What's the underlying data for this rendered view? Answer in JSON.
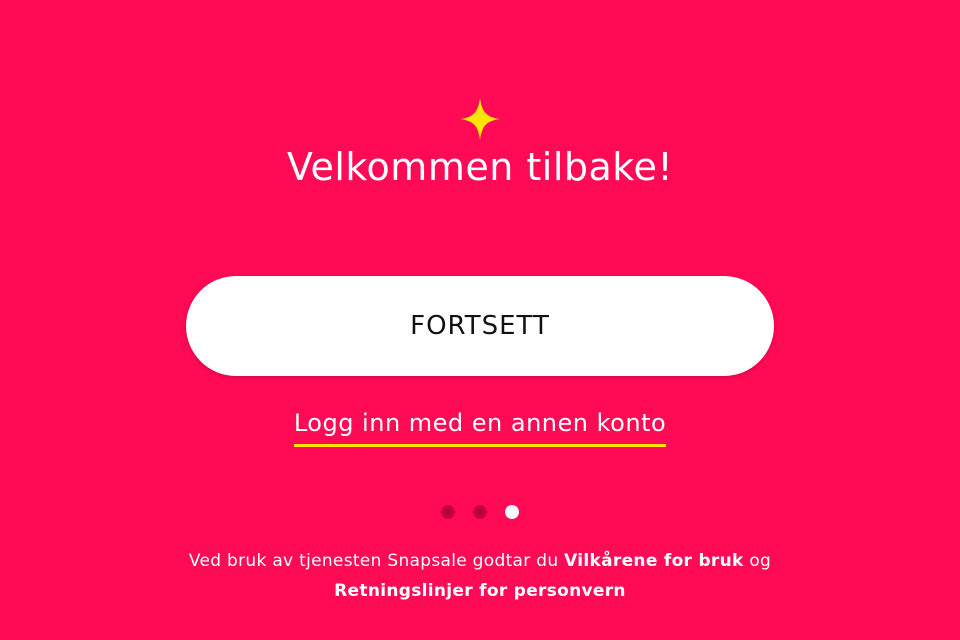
{
  "colors": {
    "background": "#ff0a54",
    "accent_yellow": "#ffe600",
    "button_bg": "#ffffff",
    "button_text": "#111111"
  },
  "header": {
    "icon": "sparkle-icon",
    "title": "Velkommen tilbake!"
  },
  "actions": {
    "continue_label": "FORTSETT",
    "alt_login_label": "Logg inn med en annen konto"
  },
  "pagination": {
    "total": 3,
    "active_index": 3
  },
  "terms": {
    "prefix": "Ved bruk av tjenesten Snapsale godtar du ",
    "terms_link": "Vilkårene for bruk",
    "middle": " og ",
    "privacy_link": "Retningslinjer for personvern"
  }
}
